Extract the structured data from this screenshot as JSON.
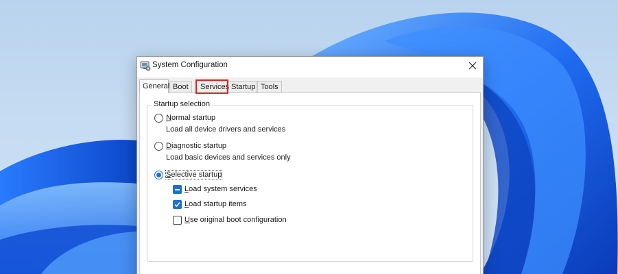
{
  "dialog": {
    "title": "System Configuration",
    "title_icon": "msconfig-icon",
    "close_icon": "close-icon"
  },
  "tabs": [
    "General",
    "Boot",
    "Services",
    "Startup",
    "Tools"
  ],
  "selected_tab": "General",
  "highlighted_tab": "Services",
  "group": {
    "legend": "Startup selection",
    "normal": {
      "accel": "N",
      "rest": "ormal startup",
      "description": "Load all device drivers and services",
      "checked": false
    },
    "diagnostic": {
      "accel": "D",
      "rest": "iagnostic startup",
      "description": "Load basic devices and services only",
      "checked": false
    },
    "selective": {
      "accel": "S",
      "rest": "elective startup",
      "checked": true
    }
  },
  "options": {
    "load_system_services": {
      "accel": "L",
      "rest": "oad system services",
      "state": "indeterminate"
    },
    "load_startup_items": {
      "accel": "L",
      "rest": "oad startup items",
      "state": "checked"
    },
    "use_original_boot": {
      "accel": "U",
      "rest": "se original boot configuration",
      "state": "unchecked"
    }
  },
  "colors": {
    "accent": "#1f6fd1",
    "highlight_box": "#c42f2f",
    "wallpaper_blue": "#1a5fd8"
  }
}
